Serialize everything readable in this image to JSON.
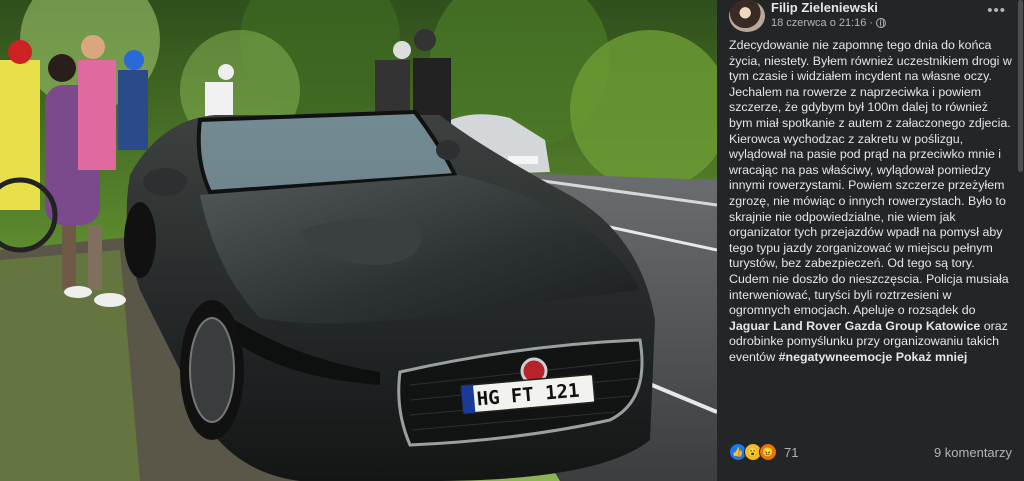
{
  "post": {
    "author": "Filip Zieleniewski",
    "date": "18 czerwca o 21:16",
    "more_label": "•••",
    "body": "Zdecydowanie nie zapomnę tego dnia do końca życia, niestety. Byłem również uczestnikiem drogi w tym czasie i widziałem incydent na własne oczy. Jechalem na rowerze z naprzeciwka i powiem szczerze, że gdybym był 100m dalej to również bym miał spotkanie z autem z załaczonego zdjecia. Kierowca wychodzac z zakretu w poślizgu, wylądował na pasie pod prąd na przeciwko mnie i wracając na pas właściwy, wylądował pomiedzy innymi rowerzystami. Powiem szczerze przeżyłem zgrozę, nie mówiąc o innych rowerzystach. Było to skrajnie nie odpowiedzialne, nie wiem jak organizator tych przejazdów wpadł na pomysł aby tego typu jazdy zorganizować w miejscu pełnym turystów, bez zabezpieczeń. Od tego są tory. Cudem nie doszło do nieszczęscia. Policja musiała interweniować, turyści byli roztrzesieni w ogromnych emocjach. Apeluje o rozsądek do",
    "mention": "Jaguar Land Rover Gazda Group Katowice",
    "body_tail": "oraz odrobinke pomyślunku przy organizowaniu takich eventów",
    "hashtag": "#negatywneemocje",
    "see_more": "Pokaż mniej",
    "reaction_count": "71",
    "comments_label": "9 komentarzy"
  },
  "photo": {
    "plate": "HG FT 121"
  },
  "icons": {
    "privacy": "globe-icon",
    "menu": "more-icon",
    "reactions": [
      "like-icon",
      "wow-icon",
      "angry-icon"
    ]
  },
  "colors": {
    "panel_bg": "#242526",
    "text": "#e4e6eb",
    "secondary": "#b0b3b8",
    "like": "#1877f2"
  }
}
